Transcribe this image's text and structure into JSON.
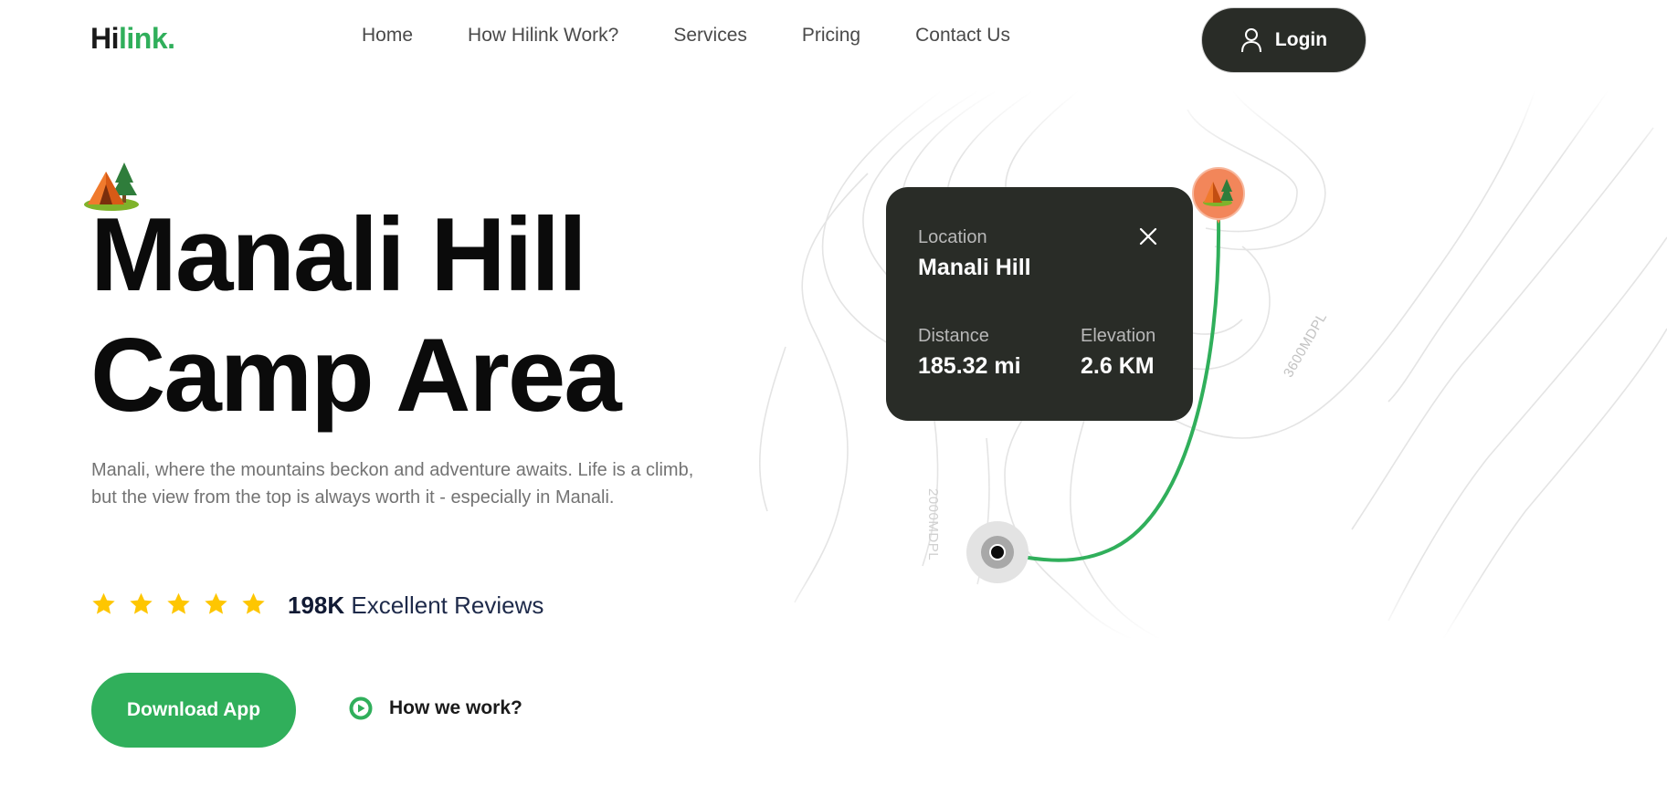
{
  "header": {
    "logo_part1": "Hi",
    "logo_part2": "link.",
    "nav": [
      "Home",
      "How Hilink Work?",
      "Services",
      "Pricing",
      "Contact Us"
    ],
    "login_label": "Login"
  },
  "hero": {
    "title_line1": "Manali Hill",
    "title_line2": "Camp Area",
    "description": "Manali, where the mountains beckon and adventure awaits. Life is a climb, but the view from the top is always worth it - especially in Manali.",
    "rating_stars": 5,
    "review_count": "198K",
    "review_text": " Excellent Reviews",
    "download_label": "Download App",
    "how_we_work_label": "How we work?"
  },
  "map": {
    "contour_label_1": "3600MDPL",
    "contour_label_2": "2000MDPL",
    "card": {
      "location_label": "Location",
      "location_value": "Manali Hill",
      "distance_label": "Distance",
      "distance_value": "185.32 mi",
      "elevation_label": "Elevation",
      "elevation_value": "2.6 KM"
    }
  },
  "colors": {
    "brand_green": "#30af5b",
    "dark": "#292c27",
    "star": "#fec601",
    "pin_orange": "#f2865a"
  },
  "icons": [
    "user-icon",
    "tent-icon",
    "star-icon",
    "play-icon",
    "close-icon",
    "location-pin-icon",
    "start-point-icon"
  ]
}
